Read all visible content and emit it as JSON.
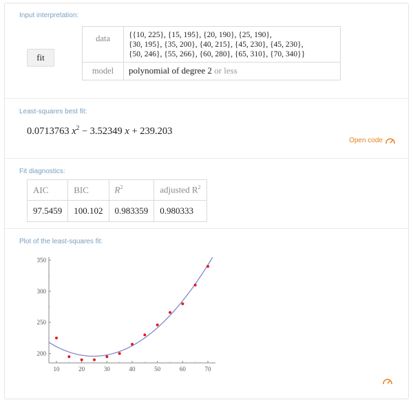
{
  "input": {
    "section_title": "Input interpretation:",
    "button_label": "fit",
    "data_key": "data",
    "data_lines": [
      "{{10, 225}, {15, 195}, {20, 190}, {25, 190},",
      "{30, 195}, {35, 200}, {40, 215}, {45, 230}, {45, 230},",
      "{50, 246}, {55, 266}, {60, 280}, {65, 310}, {70, 340}}"
    ],
    "model_key": "model",
    "model_value": "polynomial of degree 2",
    "model_suffix": " or less"
  },
  "fit": {
    "section_title": "Least-squares best fit:",
    "a": "0.0713763",
    "b": "3.52349",
    "c": "239.203",
    "x": "x",
    "exp": "2",
    "open_code_label": "Open code"
  },
  "diagnostics": {
    "section_title": "Fit diagnostics:",
    "headers": [
      "AIC",
      "BIC",
      "R",
      "adjusted R"
    ],
    "header_sup": "2",
    "values": [
      "97.5459",
      "100.102",
      "0.983359",
      "0.980333"
    ]
  },
  "plot": {
    "section_title": "Plot of the least-squares fit:"
  },
  "chart_data": {
    "type": "scatter",
    "x": [
      10,
      15,
      20,
      25,
      30,
      35,
      40,
      45,
      50,
      55,
      60,
      65,
      70
    ],
    "y": [
      225,
      195,
      190,
      190,
      195,
      200,
      215,
      230,
      246,
      266,
      280,
      310,
      340
    ],
    "fit_curve": {
      "a": 0.0713763,
      "b": -3.52349,
      "c": 239.203
    },
    "xlim": [
      7,
      73
    ],
    "ylim": [
      185,
      355
    ],
    "xticks": [
      10,
      20,
      30,
      40,
      50,
      60,
      70
    ],
    "yticks": [
      200,
      250,
      300,
      350
    ],
    "point_color": "#e8161b",
    "curve_color": "#7b7fc8",
    "grid": false
  }
}
